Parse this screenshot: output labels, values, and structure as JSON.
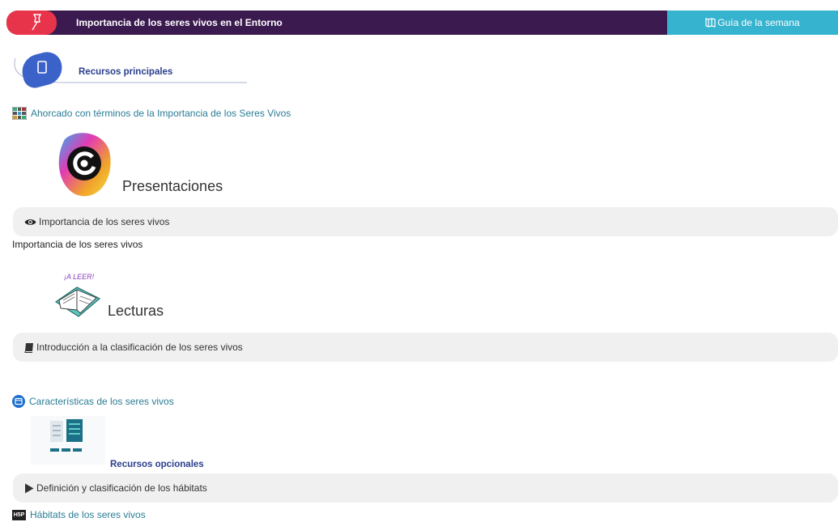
{
  "header": {
    "title": "Importancia de los seres vivos en el Entorno",
    "guide_button": "Guía de la semana"
  },
  "main_resources": {
    "title": "Recursos principales",
    "hangman_link": "Ahorcado con términos de la Importancia de los Seres Vivos"
  },
  "presentations": {
    "title": "Presentaciones",
    "bar_label": "Importancia de los seres vivos",
    "description": "Importancia de los seres vivos"
  },
  "readings": {
    "badge_text": "¡A LEER!",
    "title": "Lecturas",
    "bar_label": "Introducción a la clasificación de los seres vivos",
    "link": "Características de los seres vivos"
  },
  "optional_resources": {
    "title": "Recursos opcionales",
    "bar_label": "Definición y clasificación de los hábitats",
    "h5p_badge": "H5P",
    "link": "Hábitats de los seres vivos"
  },
  "colors": {
    "header_bg": "#3b1a4f",
    "pin_pill": "#e8344a",
    "guide_bg": "#36b3cf",
    "link": "#2a7d96",
    "section_title": "#2b3f8c"
  }
}
